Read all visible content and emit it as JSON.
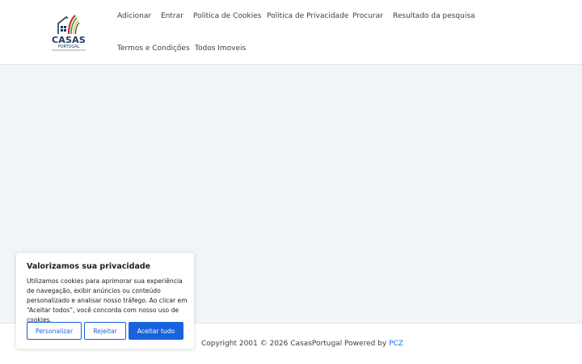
{
  "header": {
    "logo": {
      "name": "CASAS",
      "sub": "PORTUGAL"
    },
    "nav": [
      "Adicionar",
      "Entrar",
      "Politica de Cookies",
      "Politica de Privacidade",
      "Procurar",
      "Resultado da pesquisa",
      "Termos e Condições",
      "Todos Imoveis"
    ]
  },
  "footer": {
    "copyright": "Copyright 2001 © 2026 CasasPortugal Powered by ",
    "link": "PCZ"
  },
  "cookie_banner": {
    "title": "Valorizamos sua privacidade",
    "text": "Utilizamos cookies para aprimorar sua experiência de navegação, exibir anúncios ou conteúdo personalizado e analisar nosso tráfego. Ao clicar em “Aceitar todos”, você concorda com nosso uso de cookies.",
    "buttons": {
      "customize": "Personalizar",
      "reject": "Rejeitar",
      "accept": "Aceitar tudo"
    }
  },
  "colors": {
    "accent": "#1863dc",
    "link": "#1a73e8",
    "background": "#f1f5f9"
  }
}
